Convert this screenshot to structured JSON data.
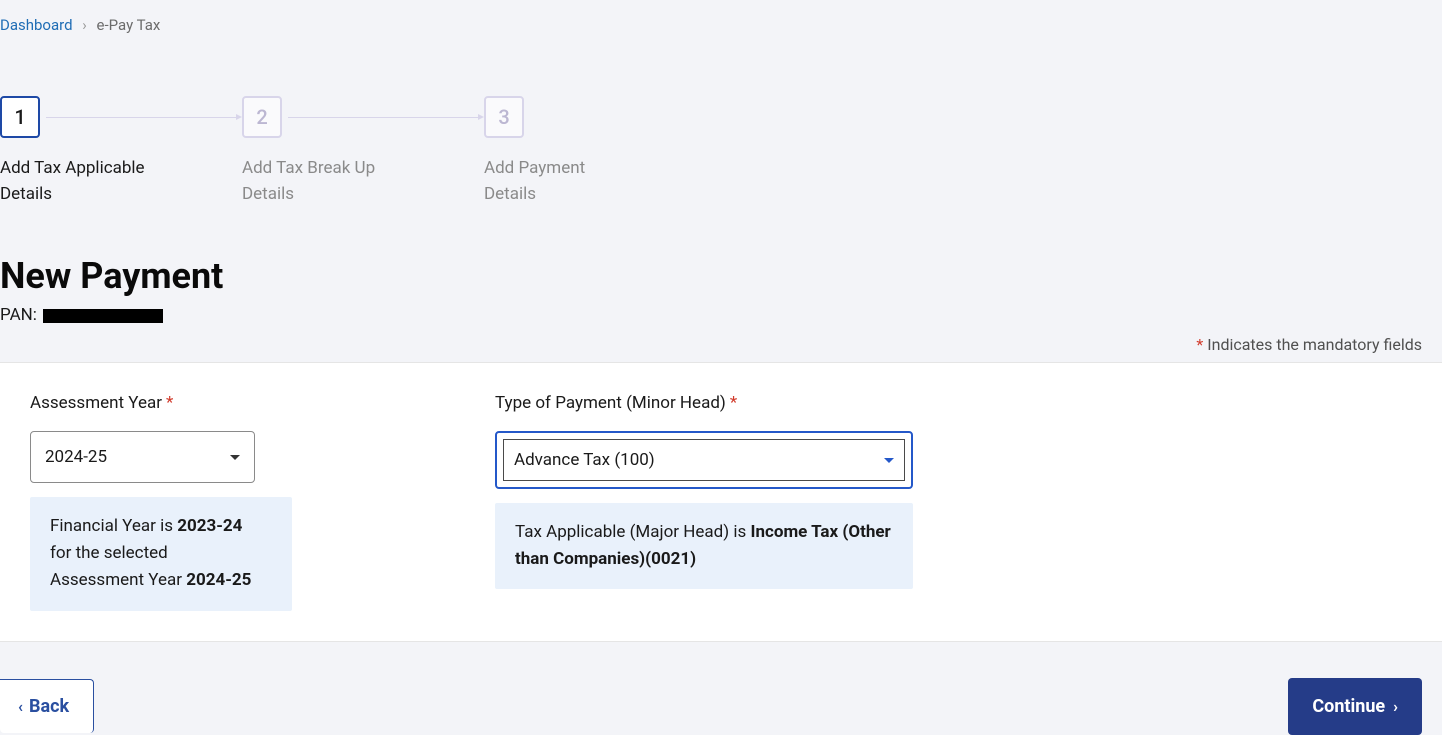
{
  "breadcrumb": {
    "home": "Dashboard",
    "current": "e-Pay Tax"
  },
  "stepper": {
    "steps": [
      {
        "num": "1",
        "label": "Add Tax Applicable Details",
        "active": true
      },
      {
        "num": "2",
        "label": "Add Tax Break Up Details",
        "active": false
      },
      {
        "num": "3",
        "label": "Add Payment Details",
        "active": false
      }
    ]
  },
  "page": {
    "title": "New Payment",
    "pan_label": "PAN:"
  },
  "notes": {
    "mandatory_prefix": "*",
    "mandatory_text": " Indicates the mandatory fields"
  },
  "form": {
    "assessment_year": {
      "label": "Assessment Year",
      "value": "2024-25",
      "info_line1_a": "Financial Year is ",
      "info_line1_b": "2023-24",
      "info_line2": "for the selected",
      "info_line3_a": "Assessment Year ",
      "info_line3_b": "2024-25"
    },
    "payment_type": {
      "label": "Type of Payment (Minor Head)",
      "value": "Advance Tax (100)",
      "info_a": "Tax Applicable (Major Head) is ",
      "info_b": "Income Tax (Other than Companies)(0021)"
    }
  },
  "actions": {
    "back": "Back",
    "continue": "Continue"
  }
}
